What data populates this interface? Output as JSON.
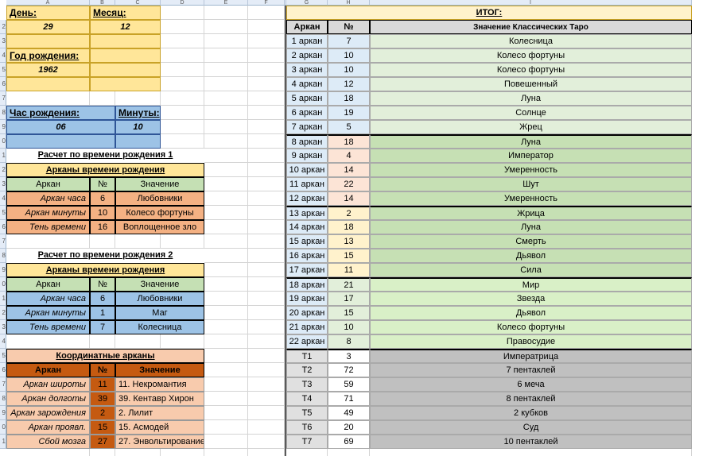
{
  "columns": [
    "A",
    "B",
    "C",
    "D",
    "E",
    "F",
    "G",
    "H",
    "I"
  ],
  "rows": [
    "",
    "2",
    "3",
    "4",
    "5",
    "6",
    "7",
    "8",
    "9",
    "0",
    "1",
    "2",
    "3",
    "4",
    "5",
    "6",
    "7",
    "8",
    "9",
    "0",
    "1",
    "2",
    "3",
    "4",
    "5",
    "6",
    "7",
    "8",
    "9",
    "0",
    "1"
  ],
  "birth": {
    "day_label": "День:",
    "day_value": "29",
    "month_label": "Месяц:",
    "month_value": "12",
    "year_label": "Год рождения:",
    "year_value": "1962",
    "hour_label": "Час рождения:",
    "hour_value": "06",
    "minutes_label": "Минуты:",
    "minutes_value": "10"
  },
  "calc1": {
    "title": "Расчет по времени рождения 1",
    "subtitle": "Арканы времени рождения",
    "head": [
      "Аркан",
      "№",
      "Значение"
    ],
    "rows": [
      [
        "Аркан часа",
        "6",
        "Любовники"
      ],
      [
        "Аркан минуты",
        "10",
        "Колесо фортуны"
      ],
      [
        "Тень времени",
        "16",
        "Воплощенное зло"
      ]
    ]
  },
  "calc2": {
    "title": "Расчет по времени рождения 2",
    "subtitle": "Арканы времени рождения",
    "head": [
      "Аркан",
      "№",
      "Значение"
    ],
    "rows": [
      [
        "Аркан часа",
        "6",
        "Любовники"
      ],
      [
        "Аркан минуты",
        "1",
        "Маг"
      ],
      [
        "Тень времени",
        "7",
        "Колесница"
      ]
    ]
  },
  "coord": {
    "title": "Координатные арканы",
    "head": [
      "Аркан",
      "№",
      "Значение"
    ],
    "rows": [
      [
        "Аркан широты",
        "11",
        "11. Некромантия"
      ],
      [
        "Аркан долготы",
        "39",
        "39. Кентавр Хирон"
      ],
      [
        "Аркан зарождения",
        "2",
        "2. Лилит"
      ],
      [
        "Аркан проявл.",
        "15",
        "15. Асмодей"
      ],
      [
        "Сбой мозга",
        "27",
        "27. Энвольтирование"
      ]
    ]
  },
  "itog": {
    "title": "ИТОГ:",
    "head": [
      "Аркан",
      "№",
      "Значение Классических Таро"
    ],
    "rows": [
      [
        "1 аркан",
        "7",
        "Колесница"
      ],
      [
        "2 аркан",
        "10",
        "Колесо фортуны"
      ],
      [
        "3 аркан",
        "10",
        "Колесо фортуны"
      ],
      [
        "4 аркан",
        "12",
        "Повешенный"
      ],
      [
        "5 аркан",
        "18",
        "Луна"
      ],
      [
        "6 аркан",
        "19",
        "Солнце"
      ],
      [
        "7 аркан",
        "5",
        "Жрец"
      ],
      [
        "8 аркан",
        "18",
        "Луна"
      ],
      [
        "9 аркан",
        "4",
        "Император"
      ],
      [
        "10 аркан",
        "14",
        "Умеренность"
      ],
      [
        "11 аркан",
        "22",
        "Шут"
      ],
      [
        "12 аркан",
        "14",
        "Умеренность"
      ],
      [
        "13 аркан",
        "2",
        "Жрица"
      ],
      [
        "14 аркан",
        "18",
        "Луна"
      ],
      [
        "15 аркан",
        "13",
        "Смерть"
      ],
      [
        "16 аркан",
        "15",
        "Дьявол"
      ],
      [
        "17 аркан",
        "11",
        "Сила"
      ],
      [
        "18 аркан",
        "21",
        "Мир"
      ],
      [
        "19 аркан",
        "17",
        "Звезда"
      ],
      [
        "20 аркан",
        "15",
        "Дьявол"
      ],
      [
        "21 аркан",
        "10",
        "Колесо фортуны"
      ],
      [
        "22 аркан",
        "8",
        "Правосудие"
      ],
      [
        "T1",
        "3",
        "Императрица"
      ],
      [
        "T2",
        "72",
        "7 пентаклей"
      ],
      [
        "T3",
        "59",
        "6 меча"
      ],
      [
        "T4",
        "71",
        "8 пентаклей"
      ],
      [
        "T5",
        "49",
        "2 кубков"
      ],
      [
        "T6",
        "20",
        "Суд"
      ],
      [
        "T7",
        "69",
        "10 пентаклей"
      ]
    ]
  },
  "colors": {
    "yellow": "#ffe699",
    "blue": "#9dc3e6",
    "salmon": "#f4b183",
    "green_head": "#c5e0b4",
    "orange_dark": "#c55a11",
    "peach": "#f8cbad",
    "itog_head": "#fff2cc",
    "light_blue": "#ddebf7",
    "light_green": "#e2efda",
    "green": "#c6e0b4",
    "brighter_green": "#d9f0c7",
    "gray": "#c0c0c0",
    "light_gray": "#e0e0e0"
  }
}
